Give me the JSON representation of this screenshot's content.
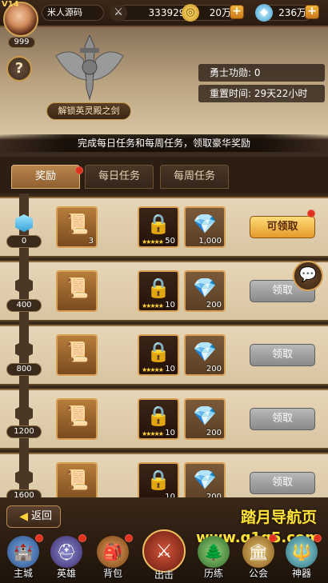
{
  "player": {
    "vip": "V14",
    "name": "米人源码",
    "level": "999"
  },
  "resources": [
    {
      "icon": "swords-icon",
      "value": "3339290"
    },
    {
      "icon": "coin-icon",
      "value": "20万"
    },
    {
      "icon": "diamond-icon",
      "value": "236万"
    }
  ],
  "banner": {
    "unlock_label": "解锁英灵殿之剑",
    "merit_label": "勇士功勋: 0",
    "reset_label": "重置时间: 29天22小时",
    "description": "完成每日任务和每周任务，领取豪华奖励"
  },
  "tabs": [
    "奖励",
    "每日任务",
    "每周任务"
  ],
  "rows": [
    {
      "milestone": "0",
      "items": [
        {
          "type": "scroll",
          "count": "3"
        },
        {
          "type": "lock-chest",
          "count": "50"
        },
        {
          "type": "diamond",
          "count": "1,000"
        }
      ],
      "button": "可领取",
      "claimable": true
    },
    {
      "milestone": "400",
      "items": [
        {
          "type": "scroll",
          "count": ""
        },
        {
          "type": "lock-chest",
          "count": "10"
        },
        {
          "type": "diamond",
          "count": "200"
        }
      ],
      "button": "领取",
      "claimable": false
    },
    {
      "milestone": "800",
      "items": [
        {
          "type": "scroll",
          "count": ""
        },
        {
          "type": "lock-chest",
          "count": "10"
        },
        {
          "type": "diamond",
          "count": "200"
        }
      ],
      "button": "领取",
      "claimable": false
    },
    {
      "milestone": "1200",
      "items": [
        {
          "type": "scroll",
          "count": ""
        },
        {
          "type": "lock-chest",
          "count": "10"
        },
        {
          "type": "diamond",
          "count": "200"
        }
      ],
      "button": "领取",
      "claimable": false
    },
    {
      "milestone": "1600",
      "items": [
        {
          "type": "scroll",
          "count": ""
        },
        {
          "type": "lock-chest",
          "count": "10"
        },
        {
          "type": "diamond",
          "count": "200"
        }
      ],
      "button": "领取",
      "claimable": false
    }
  ],
  "bottom": {
    "back_label": "返回",
    "promo_title": "踏月导航页",
    "promo_url": "www.q1q5.com",
    "nav": [
      "主城",
      "英雄",
      "背包",
      "出击",
      "历练",
      "公会",
      "神器"
    ]
  },
  "colors": {
    "accent": "#e39a2a",
    "badge": "#e0311f",
    "panel": "#d8c5a2"
  }
}
